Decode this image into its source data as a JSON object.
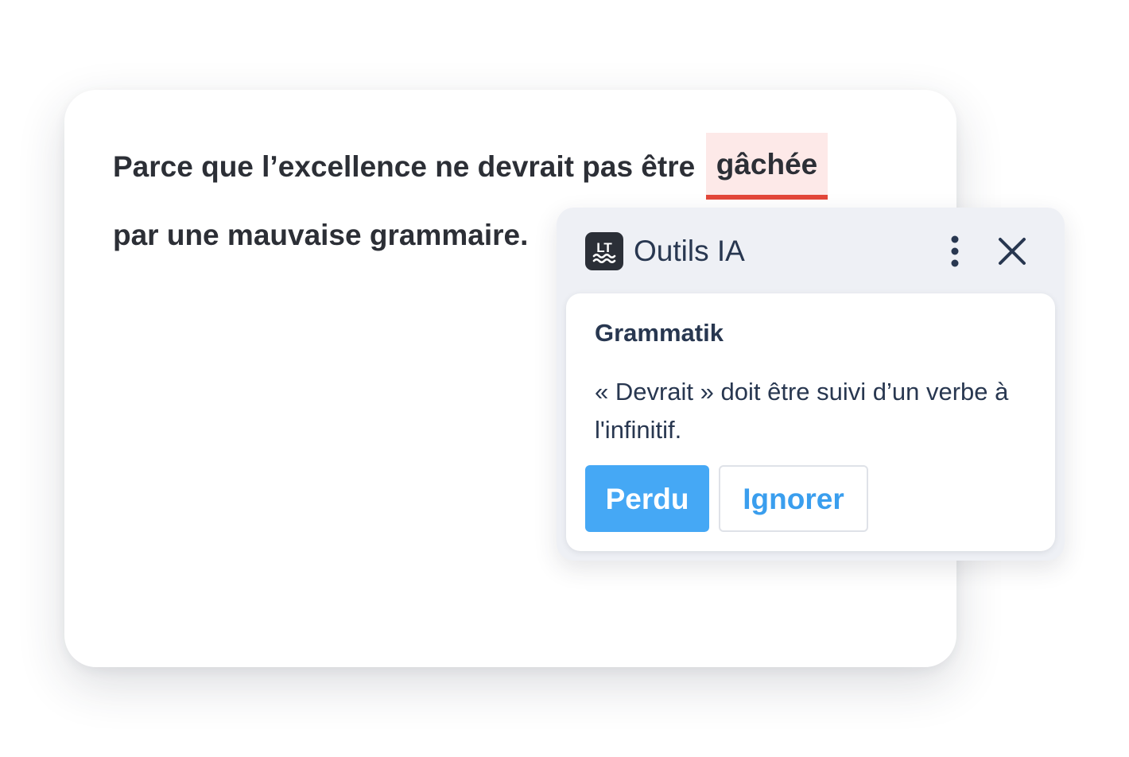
{
  "editor": {
    "line1_text": "Parce que l’excellence ne devrait pas être",
    "error_word": "gâchée",
    "line2_text": "par une mauvaise grammaire."
  },
  "popup": {
    "logo_text": "LT",
    "title": "Outils IA",
    "icons": {
      "menu": "more-vertical-icon",
      "close": "close-icon"
    },
    "suggestion": {
      "rule_name": "Grammatik",
      "message": "« Devrait » doit être suivi d’un verbe à l'infinitif.",
      "accept_label": "Perdu",
      "ignore_label": "Ignorer"
    }
  },
  "colors": {
    "error_underline": "#e3473a",
    "error_highlight": "#fde9e8",
    "primary_button": "#45a8f5",
    "popup_background": "#eef0f5",
    "text_dark": "#283750"
  }
}
